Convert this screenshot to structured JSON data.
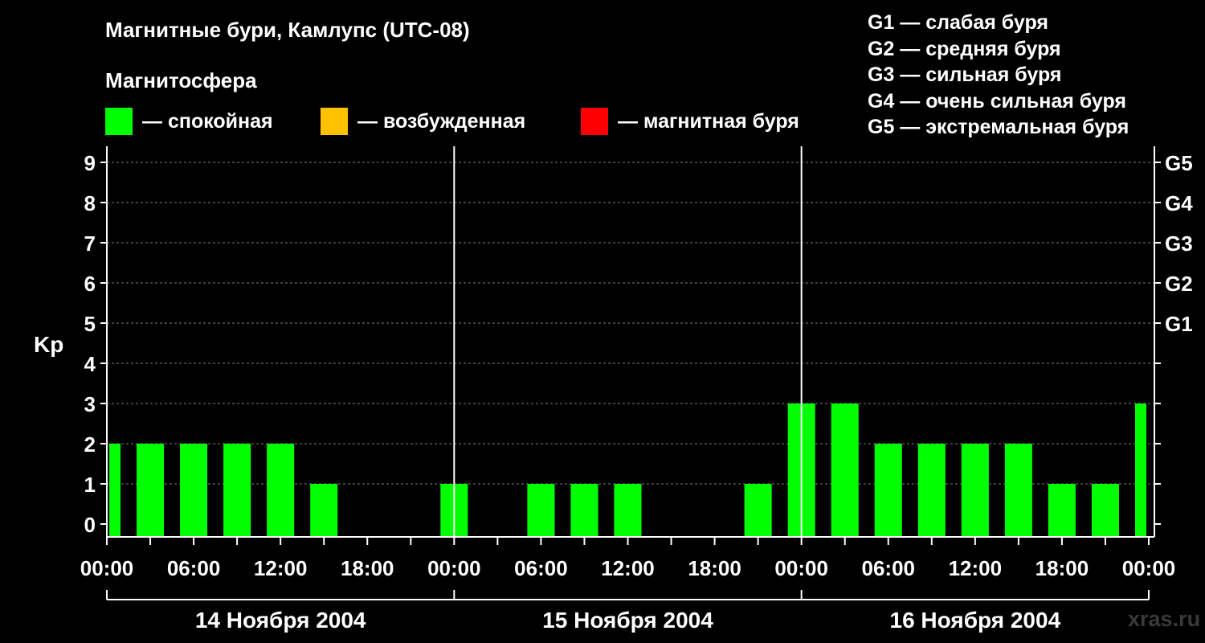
{
  "header": {
    "title": "Магнитные бури, Камлупс (UTC-08)",
    "subtitle": "Магнитосфера"
  },
  "legend": [
    {
      "label": "— спокойная",
      "color": "#00ff00"
    },
    {
      "label": "— возбужденная",
      "color": "#ffc000"
    },
    {
      "label": "— магнитная буря",
      "color": "#ff0000"
    }
  ],
  "g_legend": [
    "G1 — слабая буря",
    "G2 — средняя буря",
    "G3 — сильная буря",
    "G4 — очень сильная буря",
    "G5 — экстремальная буря"
  ],
  "watermark": "xras.ru",
  "colors": {
    "background": "#000000",
    "quiet": "#00ff00",
    "grid": "#808080",
    "axis": "#ffffff"
  },
  "chart_data": {
    "type": "bar",
    "ylabel": "Kp",
    "ylim": [
      0,
      9
    ],
    "y_ticks": [
      "0",
      "1",
      "2",
      "3",
      "4",
      "5",
      "6",
      "7",
      "8",
      "9"
    ],
    "y2_ticks": [
      {
        "kp": 5,
        "label": "G1"
      },
      {
        "kp": 6,
        "label": "G2"
      },
      {
        "kp": 7,
        "label": "G3"
      },
      {
        "kp": 8,
        "label": "G4"
      },
      {
        "kp": 9,
        "label": "G5"
      }
    ],
    "x_ticks": [
      "00:00",
      "06:00",
      "12:00",
      "18:00",
      "00:00",
      "06:00",
      "12:00",
      "18:00",
      "00:00",
      "06:00",
      "12:00",
      "18:00",
      "00:00",
      "06:00",
      "12:00",
      "18:00",
      "00:00",
      "06:00",
      "12:00",
      "18:00",
      "00:00",
      "06:00",
      "12:00",
      "18:00",
      "00:00"
    ],
    "x_tick_labels_shown": [
      "00:00",
      "06:00",
      "12:00",
      "18:00",
      "00:00",
      "06:00",
      "12:00",
      "18:00",
      "00:00",
      "06:00",
      "12:00",
      "18:00",
      "00:00"
    ],
    "day_labels": [
      "14 Ноября 2004",
      "15 Ноября 2004",
      "16 Ноября 2004"
    ],
    "grid": true,
    "series": [
      {
        "bars": [
          {
            "start": "2004-11-13 23:00",
            "end": "2004-11-14 01:00",
            "kp": 2,
            "level": "quiet"
          },
          {
            "start": "2004-11-14 02:00",
            "end": "2004-11-14 04:00",
            "kp": 2,
            "level": "quiet"
          },
          {
            "start": "2004-11-14 05:00",
            "end": "2004-11-14 07:00",
            "kp": 2,
            "level": "quiet"
          },
          {
            "start": "2004-11-14 08:00",
            "end": "2004-11-14 10:00",
            "kp": 2,
            "level": "quiet"
          },
          {
            "start": "2004-11-14 11:00",
            "end": "2004-11-14 13:00",
            "kp": 2,
            "level": "quiet"
          },
          {
            "start": "2004-11-14 14:00",
            "end": "2004-11-14 16:00",
            "kp": 1,
            "level": "quiet"
          },
          {
            "start": "2004-11-14 17:00",
            "end": "2004-11-14 19:00",
            "kp": 0,
            "level": "quiet"
          },
          {
            "start": "2004-11-14 20:00",
            "end": "2004-11-14 22:00",
            "kp": 0,
            "level": "quiet"
          },
          {
            "start": "2004-11-14 23:00",
            "end": "2004-11-15 01:00",
            "kp": 1,
            "level": "quiet"
          },
          {
            "start": "2004-11-15 02:00",
            "end": "2004-11-15 04:00",
            "kp": 0,
            "level": "quiet"
          },
          {
            "start": "2004-11-15 05:00",
            "end": "2004-11-15 07:00",
            "kp": 1,
            "level": "quiet"
          },
          {
            "start": "2004-11-15 08:00",
            "end": "2004-11-15 10:00",
            "kp": 1,
            "level": "quiet"
          },
          {
            "start": "2004-11-15 11:00",
            "end": "2004-11-15 13:00",
            "kp": 1,
            "level": "quiet"
          },
          {
            "start": "2004-11-15 14:00",
            "end": "2004-11-15 16:00",
            "kp": 0,
            "level": "quiet"
          },
          {
            "start": "2004-11-15 17:00",
            "end": "2004-11-15 19:00",
            "kp": 0,
            "level": "quiet"
          },
          {
            "start": "2004-11-15 20:00",
            "end": "2004-11-15 22:00",
            "kp": 1,
            "level": "quiet"
          },
          {
            "start": "2004-11-15 23:00",
            "end": "2004-11-16 01:00",
            "kp": 3,
            "level": "quiet"
          },
          {
            "start": "2004-11-16 02:00",
            "end": "2004-11-16 04:00",
            "kp": 3,
            "level": "quiet"
          },
          {
            "start": "2004-11-16 05:00",
            "end": "2004-11-16 07:00",
            "kp": 2,
            "level": "quiet"
          },
          {
            "start": "2004-11-16 08:00",
            "end": "2004-11-16 10:00",
            "kp": 2,
            "level": "quiet"
          },
          {
            "start": "2004-11-16 11:00",
            "end": "2004-11-16 13:00",
            "kp": 2,
            "level": "quiet"
          },
          {
            "start": "2004-11-16 14:00",
            "end": "2004-11-16 16:00",
            "kp": 2,
            "level": "quiet"
          },
          {
            "start": "2004-11-16 17:00",
            "end": "2004-11-16 19:00",
            "kp": 1,
            "level": "quiet"
          },
          {
            "start": "2004-11-16 20:00",
            "end": "2004-11-16 22:00",
            "kp": 1,
            "level": "quiet"
          },
          {
            "start": "2004-11-16 23:00",
            "end": "2004-11-17 01:00",
            "kp": 3,
            "level": "quiet"
          }
        ]
      }
    ]
  }
}
